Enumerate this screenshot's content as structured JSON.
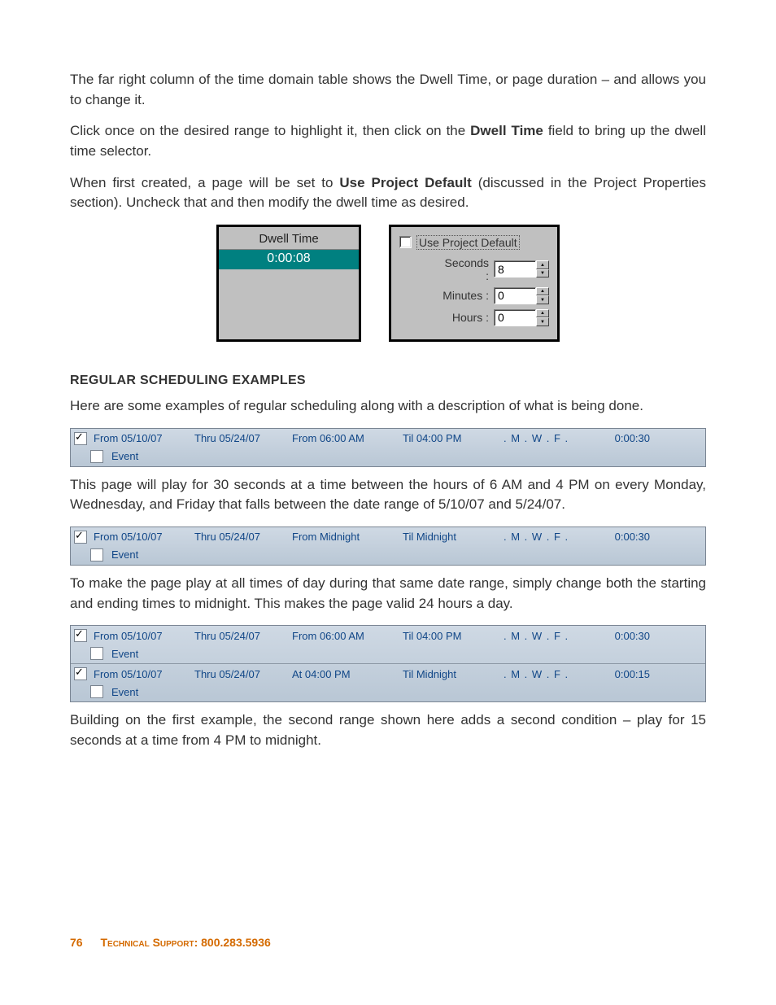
{
  "paragraphs": {
    "p1a": "The far right column of the time domain table shows the Dwell Time, or page duration – and allows you to change it.",
    "p2a": "Click once on the desired range to highlight it, then click on the ",
    "p2b": "Dwell Time",
    "p2c": " field to bring up the dwell time selector.",
    "p3a": "When first created, a page will be set to ",
    "p3b": "Use Project Default",
    "p3c": " (discussed in the Project Properties section). Uncheck that and then modify the dwell time as desired.",
    "p4": "Here are some examples of regular scheduling along with a description of what is being done.",
    "p5": "This page will play for 30 seconds at a time between the hours of 6 AM and 4 PM on every Monday, Wednesday, and Friday that falls between the date range of 5/10/07 and 5/24/07.",
    "p6": "To make the page play at all times of day during that same date range, simply change both the starting and ending times to midnight. This makes the page valid 24 hours a day.",
    "p7": "Building on the first example, the second range shown here adds a second condition – play for 15 seconds at a time from 4 PM to midnight."
  },
  "section_heading": "Regular Scheduling Examples",
  "dwell_panel": {
    "header": "Dwell Time",
    "value": "0:00:08"
  },
  "selector_panel": {
    "use_default_label": "Use Project Default",
    "rows": [
      {
        "label": "Seconds :",
        "value": "8"
      },
      {
        "label": "Minutes :",
        "value": "0"
      },
      {
        "label": "Hours :",
        "value": "0"
      }
    ]
  },
  "examples": [
    {
      "rows": [
        {
          "checked": true,
          "from": "From 05/10/07",
          "thru": "Thru 05/24/07",
          "from_time": "From 06:00 AM",
          "til": "Til 04:00 PM",
          "days": ". M . W . F .",
          "dwell": "0:00:30",
          "event_checked": false,
          "event_label": "Event"
        }
      ]
    },
    {
      "rows": [
        {
          "checked": true,
          "from": "From 05/10/07",
          "thru": "Thru 05/24/07",
          "from_time": "From Midnight",
          "til": "Til Midnight",
          "days": ". M . W . F .",
          "dwell": "0:00:30",
          "event_checked": false,
          "event_label": "Event"
        }
      ]
    },
    {
      "rows": [
        {
          "checked": true,
          "from": "From 05/10/07",
          "thru": "Thru 05/24/07",
          "from_time": "From 06:00 AM",
          "til": "Til 04:00 PM",
          "days": ". M . W . F .",
          "dwell": "0:00:30",
          "event_checked": false,
          "event_label": "Event"
        },
        {
          "checked": true,
          "from": "From 05/10/07",
          "thru": "Thru 05/24/07",
          "from_time": "At 04:00 PM",
          "til": "Til Midnight",
          "days": ". M . W . F .",
          "dwell": "0:00:15",
          "event_checked": false,
          "event_label": "Event"
        }
      ]
    }
  ],
  "footer": {
    "page_number": "76",
    "support_label": "Technical Support",
    "support_number": ": 800.283.5936"
  }
}
